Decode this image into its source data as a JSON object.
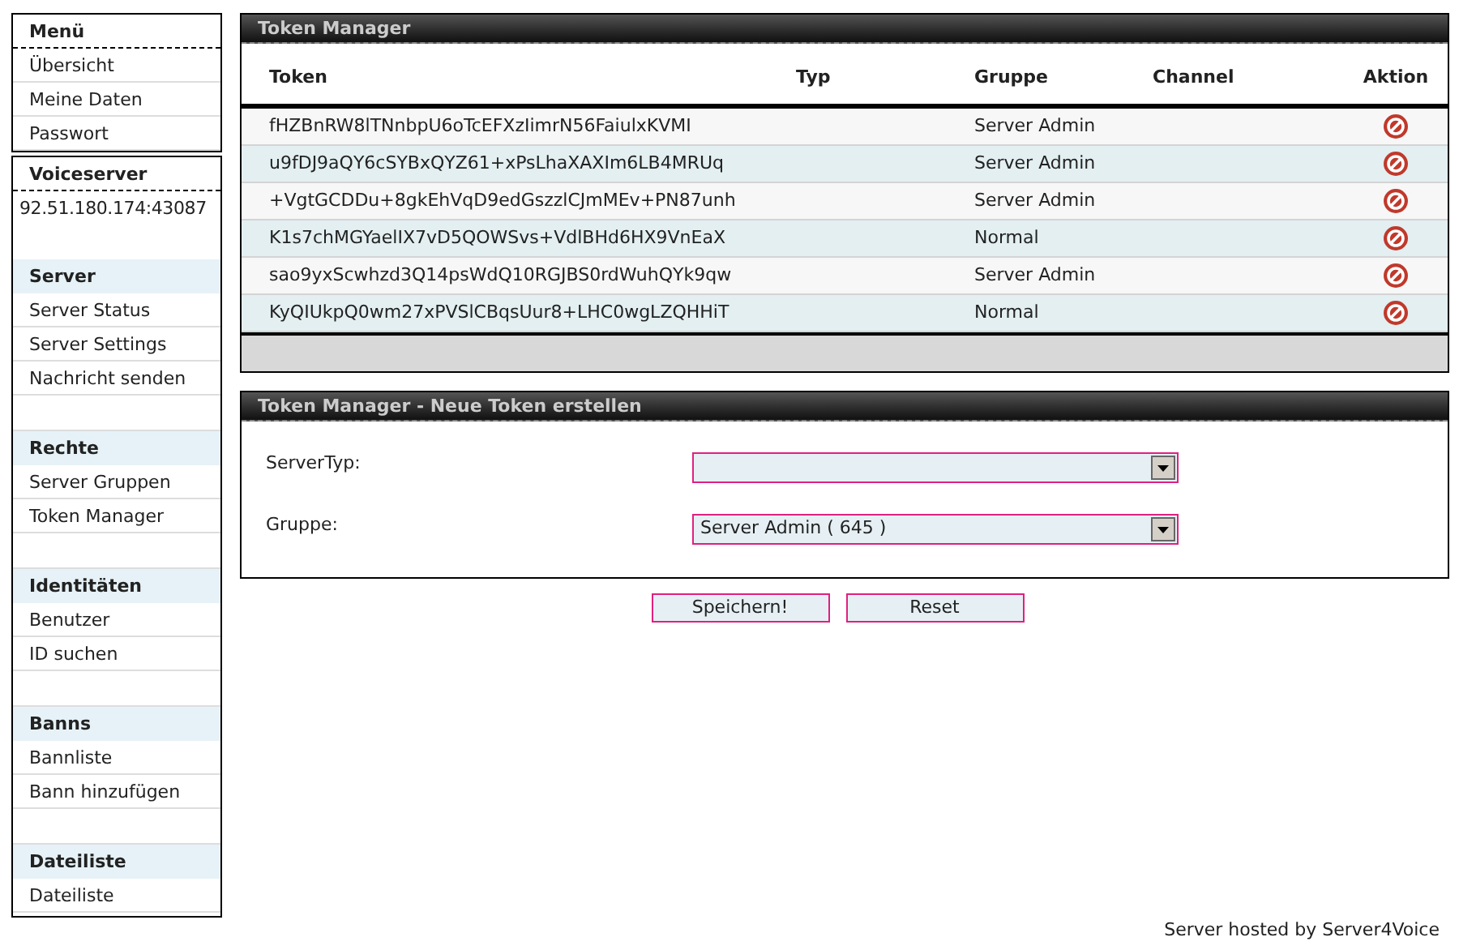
{
  "sidebar": {
    "menu": {
      "title": "Menü",
      "items": [
        "Übersicht",
        "Meine Daten",
        "Passwort"
      ]
    },
    "voiceserver": {
      "title": "Voiceserver",
      "address": "92.51.180.174:43087",
      "sections": [
        {
          "title": "Server",
          "items": [
            "Server Status",
            "Server Settings",
            "Nachricht senden"
          ]
        },
        {
          "title": "Rechte",
          "items": [
            "Server Gruppen",
            "Token Manager"
          ]
        },
        {
          "title": "Identitäten",
          "items": [
            "Benutzer",
            "ID suchen"
          ]
        },
        {
          "title": "Banns",
          "items": [
            "Bannliste",
            "Bann hinzufügen"
          ]
        },
        {
          "title": "Dateiliste",
          "items": [
            "Dateiliste"
          ]
        }
      ]
    }
  },
  "token_panel": {
    "title": "Token Manager",
    "columns": [
      "Token",
      "Typ",
      "Gruppe",
      "Channel",
      "Aktion"
    ],
    "rows": [
      {
        "token": "fHZBnRW8lTNnbpU6oTcEFXzIimrN56FaiulxKVMI",
        "group": "Server Admin"
      },
      {
        "token": "u9fDJ9aQY6cSYBxQYZ61+xPsLhaXAXIm6LB4MRUq",
        "group": "Server Admin"
      },
      {
        "token": "+VgtGCDDu+8gkEhVqD9edGszzlCJmMEv+PN87unh",
        "group": "Server Admin"
      },
      {
        "token": "K1s7chMGYaelIX7vD5QOWSvs+VdlBHd6HX9VnEaX",
        "group": "Normal"
      },
      {
        "token": "sao9yxScwhzd3Q14psWdQ10RGJBS0rdWuhQYk9qw",
        "group": "Server Admin"
      },
      {
        "token": "KyQIUkpQ0wm27xPVSlCBqsUur8+LHC0wgLZQHHiT",
        "group": "Normal"
      }
    ]
  },
  "create_panel": {
    "title": "Token Manager - Neue Token erstellen",
    "fields": [
      {
        "label": "ServerTyp:"
      },
      {
        "label": "Gruppe:",
        "value": "Server Admin ( 645 )"
      }
    ],
    "buttons": [
      "Speichern!",
      "Reset"
    ]
  },
  "footer": "Server hosted by Server4Voice"
}
